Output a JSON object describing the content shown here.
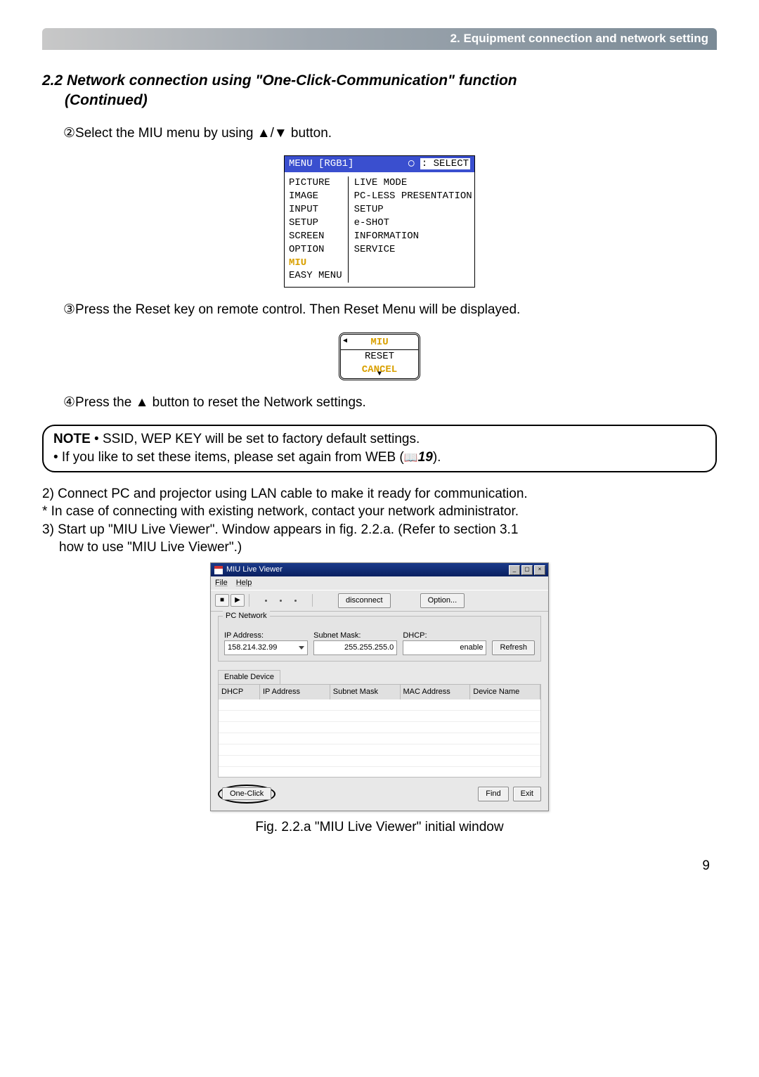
{
  "header": "2. Equipment connection and network setting",
  "section_title_line1": "2.2 Network connection using \"One-Click-Communication\" function",
  "section_title_line2": "(Continued)",
  "step2": "②Select the MIU menu by using ▲/▼ button.",
  "menu": {
    "title_left": "MENU [RGB1]",
    "title_right": ": SELECT",
    "left": [
      "PICTURE",
      "IMAGE",
      "INPUT",
      "SETUP",
      "SCREEN",
      "OPTION",
      "MIU",
      "EASY MENU"
    ],
    "right": [
      "LIVE MODE",
      "PC-LESS PRESENTATION",
      "SETUP",
      "e-SHOT",
      "INFORMATION",
      "SERVICE"
    ]
  },
  "step3": "③Press the Reset key on remote control. Then Reset Menu will be displayed.",
  "reset": {
    "miu": "MIU",
    "reset": "RESET",
    "cancel": "CANCEL"
  },
  "step4": "④Press the ▲ button to reset the Network settings.",
  "note": {
    "label": "NOTE",
    "line1": " • SSID, WEP KEY will be set to factory default settings.",
    "line2_a": "• If you like to set these items, please set again from WEB (",
    "line2_ref": "19",
    "line2_b": ")."
  },
  "para2": "2) Connect PC and projector using LAN cable to make it ready for communication.",
  "para2s": "* In case of connecting with existing network, contact your network administrator.",
  "para3a": "3) Start up \"MIU Live Viewer\". Window appears in fig. 2.2.a. (Refer to section 3.1",
  "para3b": "how to use \"MIU Live Viewer\".)",
  "app": {
    "title": "MIU Live Viewer",
    "menu": {
      "file": "File",
      "help": "Help"
    },
    "toolbar": {
      "disconnect": "disconnect",
      "option": "Option..."
    },
    "pcnetwork": {
      "legend": "PC Network",
      "ip_label": "IP Address:",
      "ip_value": "158.214.32.99",
      "subnet_label": "Subnet Mask:",
      "subnet_value": "255.255.255.0",
      "dhcp_label": "DHCP:",
      "dhcp_value": "enable",
      "refresh": "Refresh"
    },
    "tab": "Enable Device",
    "grid": {
      "c1": "DHCP",
      "c2": "IP Address",
      "c3": "Subnet Mask",
      "c4": "MAC Address",
      "c5": "Device Name"
    },
    "oneclick": "One-Click",
    "find": "Find",
    "exit": "Exit"
  },
  "figcap": "Fig. 2.2.a \"MIU Live Viewer\" initial window",
  "page": "9"
}
